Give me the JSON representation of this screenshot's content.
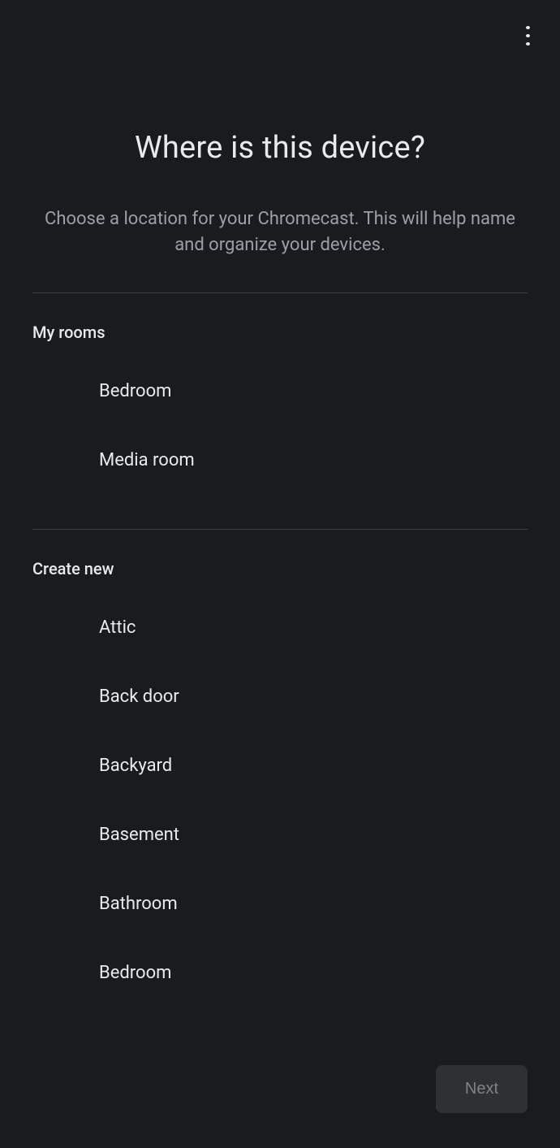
{
  "header": {
    "title": "Where is this device?",
    "subtitle": "Choose a location for your Chromecast. This will help name and organize your devices."
  },
  "sections": {
    "my_rooms": {
      "label": "My rooms",
      "items": [
        {
          "label": "Bedroom"
        },
        {
          "label": "Media room"
        }
      ]
    },
    "create_new": {
      "label": "Create new",
      "items": [
        {
          "label": "Attic"
        },
        {
          "label": "Back door"
        },
        {
          "label": "Backyard"
        },
        {
          "label": "Basement"
        },
        {
          "label": "Bathroom"
        },
        {
          "label": "Bedroom"
        }
      ]
    }
  },
  "footer": {
    "next_label": "Next"
  }
}
